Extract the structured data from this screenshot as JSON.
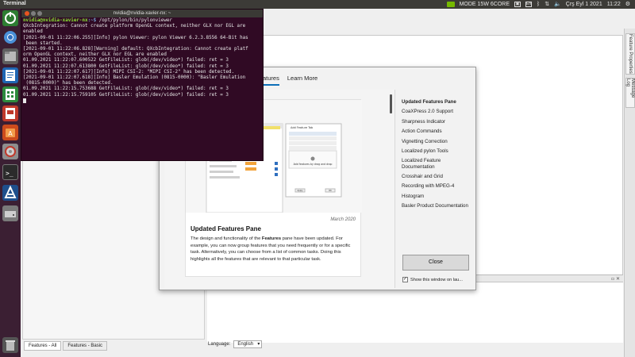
{
  "topbar": {
    "app_name": "Terminal",
    "mode": "MODE 15W 6CORE",
    "keyboard": "En",
    "date": "Çrş Eyl 1 2021",
    "time": "11:22"
  },
  "terminal": {
    "title": "nvidia@nvidia-xavier-nx: ~",
    "prompt_user": "nvidia@nvidia-xavier-nx",
    "prompt_path": ":~$ ",
    "command": "/opt/pylon/bin/pylonviewer",
    "lines": [
      "QXcbIntegration: Cannot create platform OpenGL context, neither GLX nor EGL are",
      "enabled",
      "[2021-09-01 11:22:06.255][Info] pylon Viewer: pylon Viewer 6.2.3.8556 64-Bit has",
      " been started.",
      "[2021-09-01 11:22:06.828][Warning] default: QXcbIntegration: Cannot create platf",
      "orm OpenGL context, neither GLX nor EGL are enabled",
      "01.09.2021 11:22:07.600522 GetFileList: glob(/dev/video*) failed: ret = 3",
      "01.09.2021 11:22:07.613800 GetFileList: glob(/dev/video*) failed: ret = 3",
      "[2021-09-01 11:22:07.617][Info] MIPI CSI-2: \"MIPI CSI-2\" has been detected.",
      "[2021-09-01 11:22:07.618][Info] Basler Emulation (0815-0000): \"Basler Emulation",
      " (0815-0000)\" has been detected.",
      "01.09.2021 11:22:15.753688 GetFileList: glob(/dev/video*) failed: ret = 3",
      "01.09.2021 11:22:15.759105 GetFileList: glob(/dev/video*) failed: ret = 3"
    ]
  },
  "dialog": {
    "tabs": [
      "atures",
      "Learn More"
    ],
    "card": {
      "date": "March 2020",
      "title": "Updated Features Pane",
      "text_a": "The design and functionality of the ",
      "text_bold": "Features",
      "text_b": " pane have been updated. For example, you can now group features that you need frequently or for a specific task. Alternatively, you can choose from a list of common tasks. Doing this highlights all the features that are relevant to that particular task."
    },
    "feature_list": [
      "Updated Features Pane",
      "CoaXPress 2.0 Support",
      "Sharpness Indicator",
      "Action Commands",
      "Vignetting Correction",
      "Localized pylon Tools",
      "Localized Feature Documentation",
      "Crosshair and Grid",
      "Recording with MPEG-4",
      "Histogram",
      "Basler Product Documentation"
    ],
    "close_label": "Close",
    "show_label": "Show this window on lau...",
    "shot": {
      "popup_title": "Add Feature Tab",
      "hint": "Add features by drag and drop",
      "apply": "Apply",
      "ok": "OK"
    }
  },
  "pylon": {
    "right_tabs": [
      "Feature Properties",
      "Message Log"
    ],
    "bottom_tabs": [
      "Features - All",
      "Features - Basic"
    ],
    "language_label": "Language:",
    "language_value": "English"
  }
}
